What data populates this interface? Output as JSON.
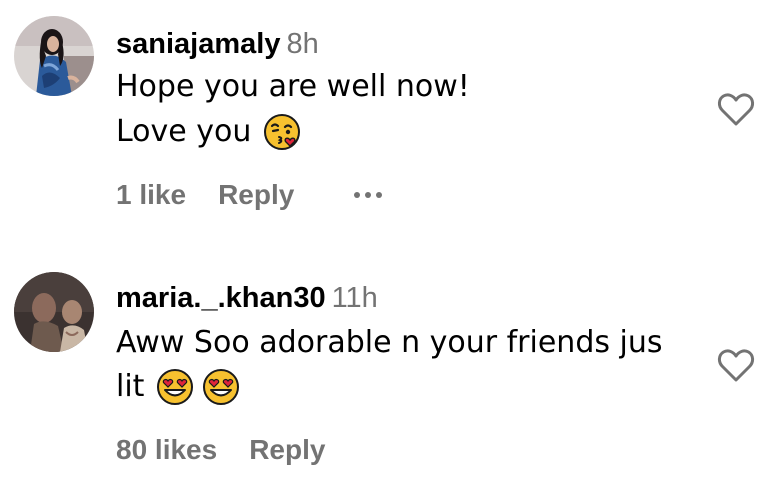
{
  "comments": [
    {
      "username": "saniajamaly",
      "time": "8h",
      "text_lines": [
        "Hope you are well now!",
        "Love you"
      ],
      "emojis": [
        "face-blowing-a-kiss"
      ],
      "likes": "1 like",
      "reply_label": "Reply",
      "more_options": true
    },
    {
      "username": "maria._.khan30",
      "time": "11h",
      "text_lines": [
        "Aww Soo adorable n your friends jus",
        "lit"
      ],
      "emojis": [
        "smiling-face-with-heart-eyes",
        "smiling-face-with-heart-eyes"
      ],
      "likes": "80 likes",
      "reply_label": "Reply",
      "more_options": false
    }
  ],
  "colors": {
    "primary_text": "#000000",
    "secondary_text": "#737373",
    "background": "#ffffff",
    "heart_outline": "#737373"
  },
  "icons": {
    "like": "heart-outline-icon",
    "more": "ellipsis-horizontal-icon"
  }
}
